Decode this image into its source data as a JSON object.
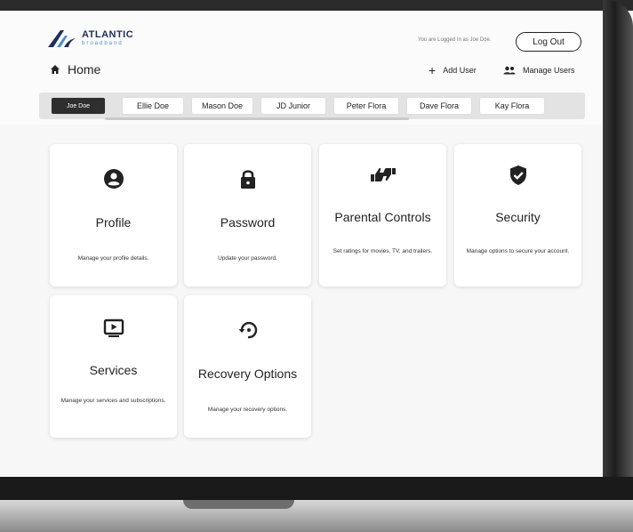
{
  "header": {
    "brand_name": "ATLANTIC",
    "brand_sub": "broadband",
    "logged_in_text": "You are Logged In as Joe Doe.",
    "logout_label": "Log Out",
    "home_label": "Home",
    "add_user_label": "Add User",
    "manage_users_label": "Manage Users"
  },
  "tabs": [
    {
      "label": "Joe Doe",
      "active": true
    },
    {
      "label": "Ellie Doe"
    },
    {
      "label": "Mason Doe"
    },
    {
      "label": "JD Junior"
    },
    {
      "label": "Peter Flora"
    },
    {
      "label": "Dave Flora"
    },
    {
      "label": "Kay Flora"
    }
  ],
  "cards": [
    {
      "icon": "user-circle-icon",
      "title": "Profile",
      "desc": "Manage your profile details."
    },
    {
      "icon": "lock-icon",
      "title": "Password",
      "desc": "Update your password."
    },
    {
      "icon": "thumbs-icon",
      "title": "Parental Controls",
      "desc": "Set ratings for movies, TV, and trailers."
    },
    {
      "icon": "shield-check-icon",
      "title": "Security",
      "desc": "Manage options to secure your account."
    },
    {
      "icon": "play-screen-icon",
      "title": "Services",
      "desc": "Manage your services and subscriptions."
    },
    {
      "icon": "restore-icon",
      "title": "Recovery Options",
      "desc": "Manage your recovery options."
    }
  ],
  "colors": {
    "brand_navy": "#1d2f5a",
    "brand_blue": "#4a8fd1",
    "active_tab": "#2e2e2e"
  }
}
